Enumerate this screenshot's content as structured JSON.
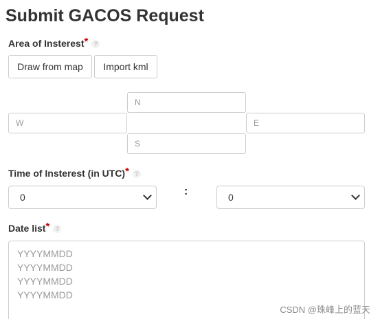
{
  "title": "Submit GACOS Request",
  "area": {
    "label": "Area of Insterest",
    "required_mark": "*",
    "help": "?",
    "draw_button": "Draw from map",
    "import_button": "Import kml",
    "north_placeholder": "N",
    "west_placeholder": "W",
    "east_placeholder": "E",
    "south_placeholder": "S"
  },
  "time": {
    "label": "Time of Insterest (in UTC)",
    "required_mark": "*",
    "help": "?",
    "hour_value": "0",
    "separator": ":",
    "minute_value": "0"
  },
  "dates": {
    "label": "Date list",
    "required_mark": "*",
    "help": "?",
    "placeholder_lines": [
      "YYYYMMDD",
      "YYYYMMDD",
      "YYYYMMDD",
      "YYYYMMDD"
    ]
  },
  "watermark": "CSDN @珠峰上的蓝天",
  "colors": {
    "required": "#cc0000",
    "border": "#cccccc",
    "placeholder": "#999999",
    "text": "#333333"
  }
}
